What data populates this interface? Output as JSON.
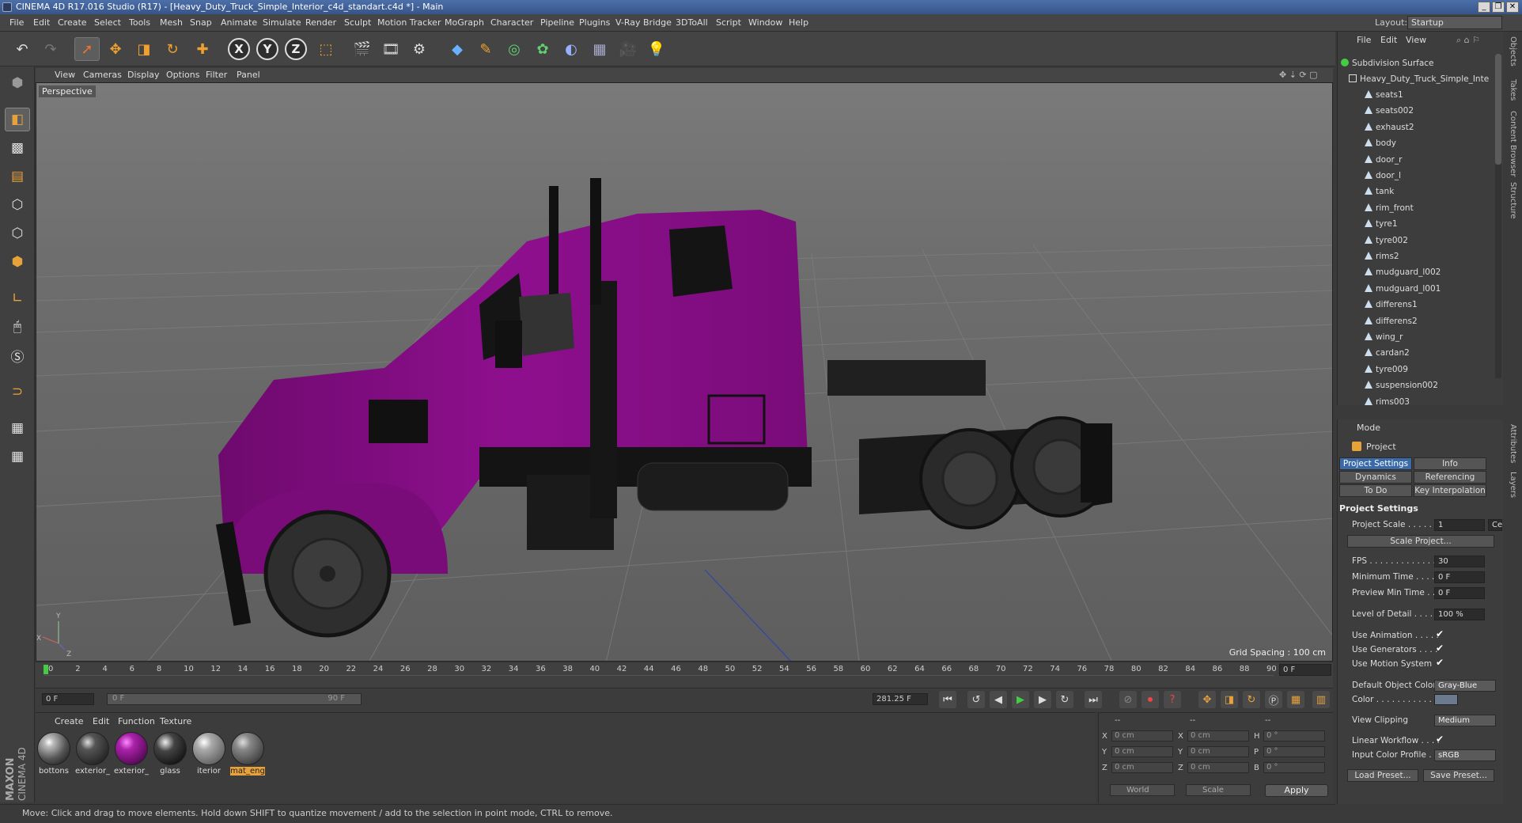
{
  "window": {
    "title": "CINEMA 4D R17.016 Studio (R17) - [Heavy_Duty_Truck_Simple_Interior_c4d_standart.c4d *] - Main",
    "minimize": "_",
    "maximize": "❐",
    "close": "✕"
  },
  "menu": [
    "File",
    "Edit",
    "Create",
    "Select",
    "Tools",
    "Mesh",
    "Snap",
    "Animate",
    "Simulate",
    "Render",
    "Sculpt",
    "Motion Tracker",
    "MoGraph",
    "Character",
    "Pipeline",
    "Plugins",
    "V-Ray Bridge",
    "3DToAll",
    "Script",
    "Window",
    "Help"
  ],
  "layout": {
    "label": "Layout:",
    "value": "Startup"
  },
  "toolbar_icons": [
    "undo-icon",
    "redo-icon",
    "select-icon",
    "move-icon",
    "scale-icon",
    "rotate-icon",
    "live-select-icon",
    "x-axis",
    "y-axis",
    "z-axis",
    "coord-system-icon",
    "render-view-icon",
    "render-picture-viewer-icon",
    "render-settings-icon",
    "cube-icon",
    "pen-icon",
    "subdivision-icon",
    "cloner-icon",
    "deformer-icon",
    "floor-icon",
    "camera-icon",
    "light-icon"
  ],
  "axes": {
    "x": "X",
    "y": "Y",
    "z": "Z"
  },
  "viewport": {
    "menu": [
      "View",
      "Cameras",
      "Display",
      "Options",
      "Filter",
      "Panel"
    ],
    "label": "Perspective",
    "grid_spacing": "Grid Spacing : 100 cm",
    "axis_y": "Y",
    "axis_z": "Z",
    "axis_x": "X"
  },
  "timeline": {
    "ticks": [
      "0",
      "2",
      "4",
      "6",
      "8",
      "10",
      "12",
      "14",
      "16",
      "18",
      "20",
      "22",
      "24",
      "26",
      "28",
      "30",
      "32",
      "34",
      "36",
      "38",
      "40",
      "42",
      "44",
      "46",
      "48",
      "50",
      "52",
      "54",
      "56",
      "58",
      "60",
      "62",
      "64",
      "66",
      "68",
      "70",
      "72",
      "74",
      "76",
      "78",
      "80",
      "82",
      "84",
      "86",
      "88",
      "90"
    ],
    "current_frame": "0 F",
    "start_frame": "0 F",
    "range_start": "0 F",
    "range_end": "90 F",
    "fps_display": "281.25 F"
  },
  "materials": {
    "menu": [
      "Create",
      "Edit",
      "Function",
      "Texture"
    ],
    "items": [
      {
        "name": "bottons",
        "selected": false
      },
      {
        "name": "exterior_",
        "selected": false
      },
      {
        "name": "exterior_",
        "selected": false
      },
      {
        "name": "glass",
        "selected": false
      },
      {
        "name": "iterior",
        "selected": false
      },
      {
        "name": "mat_eng",
        "selected": true
      }
    ]
  },
  "coords": {
    "header": [
      "--",
      "--",
      "--"
    ],
    "rows": [
      {
        "axis": "X",
        "pos": "0 cm",
        "axis2": "X",
        "size": "0 cm",
        "axis3": "H",
        "rot": "0 °"
      },
      {
        "axis": "Y",
        "pos": "0 cm",
        "axis2": "Y",
        "size": "0 cm",
        "axis3": "P",
        "rot": "0 °"
      },
      {
        "axis": "Z",
        "pos": "0 cm",
        "axis2": "Z",
        "size": "0 cm",
        "axis3": "B",
        "rot": "0 °"
      }
    ],
    "world": "World",
    "scale": "Scale",
    "apply": "Apply"
  },
  "brand": {
    "line1": "MAXON",
    "line2": "CINEMA 4D"
  },
  "status": "Move: Click and drag to move elements. Hold down SHIFT to quantize movement / add to the selection in point mode, CTRL to remove.",
  "objects": {
    "menu": [
      "File",
      "Edit",
      "View"
    ],
    "root": "Subdivision Surface",
    "child": "Heavy_Duty_Truck_Simple_Inte",
    "items": [
      "seats1",
      "seats002",
      "exhaust2",
      "body",
      "door_r",
      "door_l",
      "tank",
      "rim_front",
      "tyre1",
      "tyre002",
      "rims2",
      "mudguard_l002",
      "mudguard_l001",
      "differens1",
      "differens2",
      "wing_r",
      "cardan2",
      "tyre009",
      "suspension002",
      "rims003"
    ]
  },
  "attributes": {
    "mode": "Mode",
    "object": "Project",
    "tabs": [
      {
        "label": "Project Settings",
        "selected": true
      },
      {
        "label": "Info",
        "selected": false
      },
      {
        "label": "Dynamics",
        "selected": false
      },
      {
        "label": "Referencing",
        "selected": false
      },
      {
        "label": "To Do",
        "selected": false
      },
      {
        "label": "Key Interpolation",
        "selected": false
      }
    ],
    "section": "Project Settings",
    "project_scale_label": "Project Scale . . . . . .",
    "project_scale": "1",
    "project_scale_unit": "Ce",
    "scale_project": "Scale Project...",
    "fps_label": "FPS . . . . . . . . . . . . . .",
    "fps": "30",
    "min_time_label": "Minimum Time . . . . .",
    "min_time": "0 F",
    "preview_min_label": "Preview Min Time . . .",
    "preview_min": "0 F",
    "lod_label": "Level of Detail . . . . .",
    "lod": "100 %",
    "use_anim_label": "Use Animation . . . . .",
    "use_gen_label": "Use Generators . . . .",
    "use_motion_label": "Use Motion System",
    "default_color_label": "Default Object Color",
    "default_color": "Gray-Blue",
    "color_label": "Color . . . . . . . . . . .",
    "view_clipping_label": "View Clipping",
    "view_clipping": "Medium",
    "linear_wf_label": "Linear Workflow . . . .",
    "input_profile_label": "Input Color Profile . .",
    "input_profile": "sRGB",
    "load_preset": "Load Preset...",
    "save_preset": "Save Preset...",
    "checkmark": "✔"
  },
  "side_tabs": [
    "Objects",
    "Takes",
    "Content Browser",
    "Structure",
    "Attributes",
    "Layers"
  ],
  "colors": {
    "truck_body": "#8e0f8e",
    "selection": "#3b6aa8",
    "highlight": "#e8a23a"
  }
}
